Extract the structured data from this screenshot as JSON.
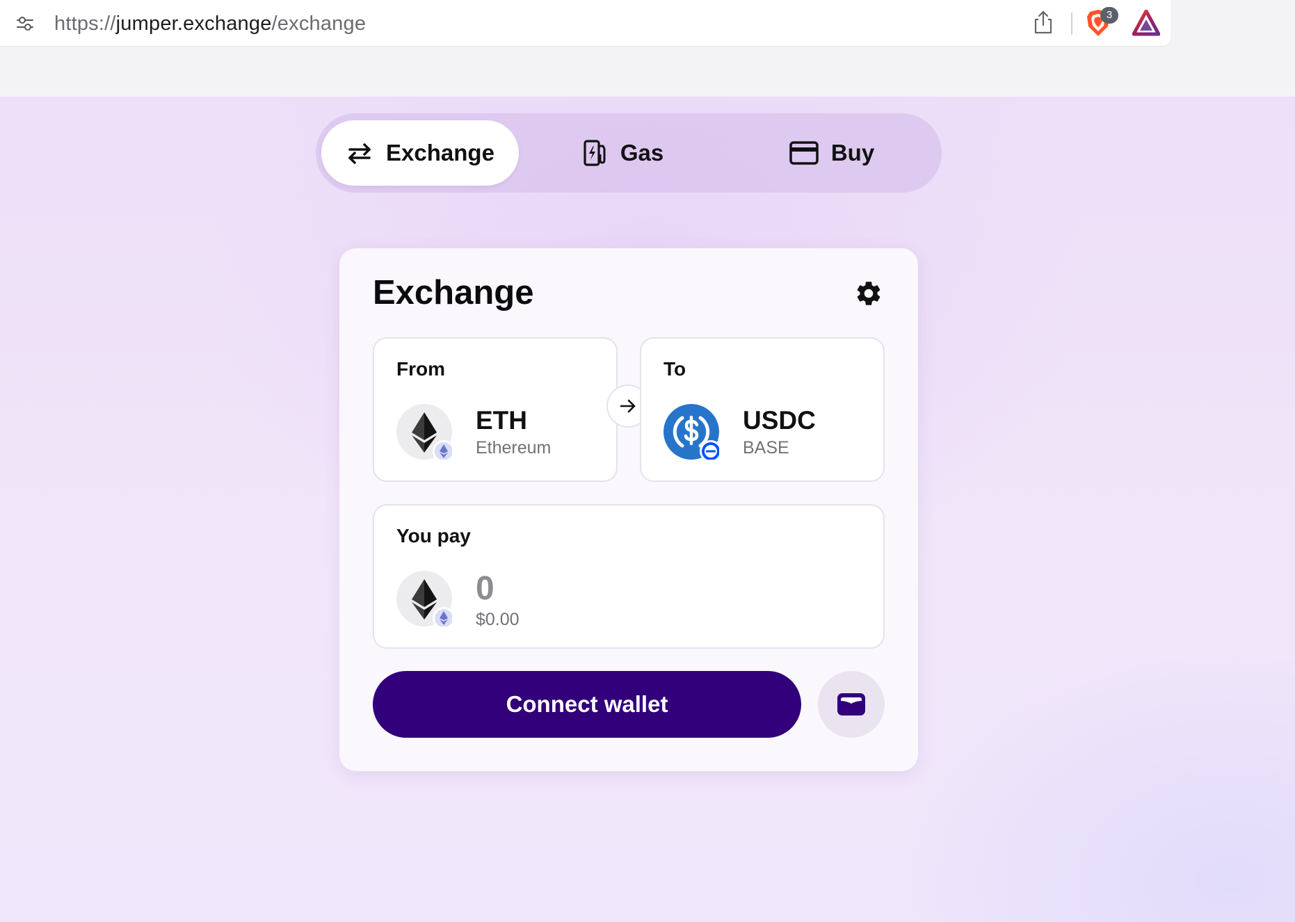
{
  "browser": {
    "url_scheme": "https://",
    "url_host": "jumper.exchange",
    "url_path": "/exchange",
    "shield_count": "3"
  },
  "nav": {
    "tabs": [
      {
        "label": "Exchange",
        "icon": "swap-arrows-icon",
        "active": true
      },
      {
        "label": "Gas",
        "icon": "gas-pump-icon",
        "active": false
      },
      {
        "label": "Buy",
        "icon": "credit-card-icon",
        "active": false
      }
    ]
  },
  "card": {
    "title": "Exchange",
    "from": {
      "label": "From",
      "symbol": "ETH",
      "chain": "Ethereum"
    },
    "to": {
      "label": "To",
      "symbol": "USDC",
      "chain": "BASE"
    },
    "pay": {
      "label": "You pay",
      "amount": "0",
      "usd": "$0.00"
    },
    "connect_label": "Connect wallet"
  },
  "colors": {
    "accent": "#31007a",
    "usdc_blue": "#2775ca",
    "base_blue": "#0052ff"
  }
}
